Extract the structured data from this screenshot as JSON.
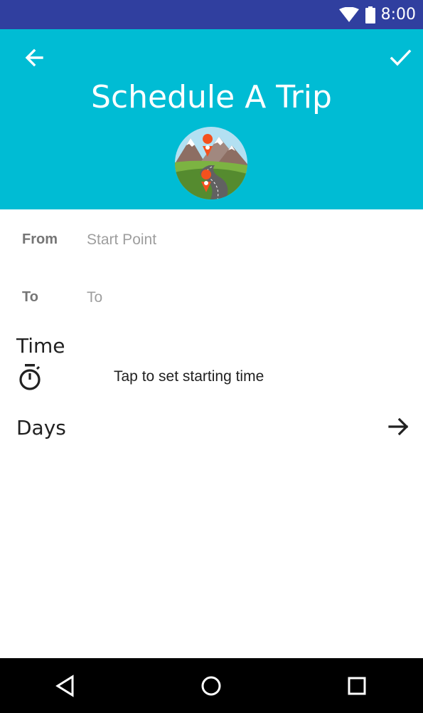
{
  "status_bar": {
    "time": "8:00",
    "icons": [
      "wifi-icon",
      "battery-icon"
    ],
    "background": "#303F9F"
  },
  "header": {
    "title": "Schedule A Trip",
    "background": "#00BCD4",
    "back_icon": "arrow-back-icon",
    "confirm_icon": "check-icon",
    "avatar": "mountain-road-icon"
  },
  "form": {
    "from": {
      "label": "From",
      "placeholder": "Start Point",
      "value": ""
    },
    "to": {
      "label": "To",
      "placeholder": "To",
      "value": ""
    },
    "time": {
      "heading": "Time",
      "icon": "stopwatch-icon",
      "hint": "Tap to set starting time"
    },
    "days": {
      "heading": "Days",
      "icon": "arrow-forward-icon"
    }
  },
  "nav_bar": {
    "buttons": [
      "back-triangle-icon",
      "home-circle-icon",
      "recents-square-icon"
    ],
    "background": "#000000"
  }
}
